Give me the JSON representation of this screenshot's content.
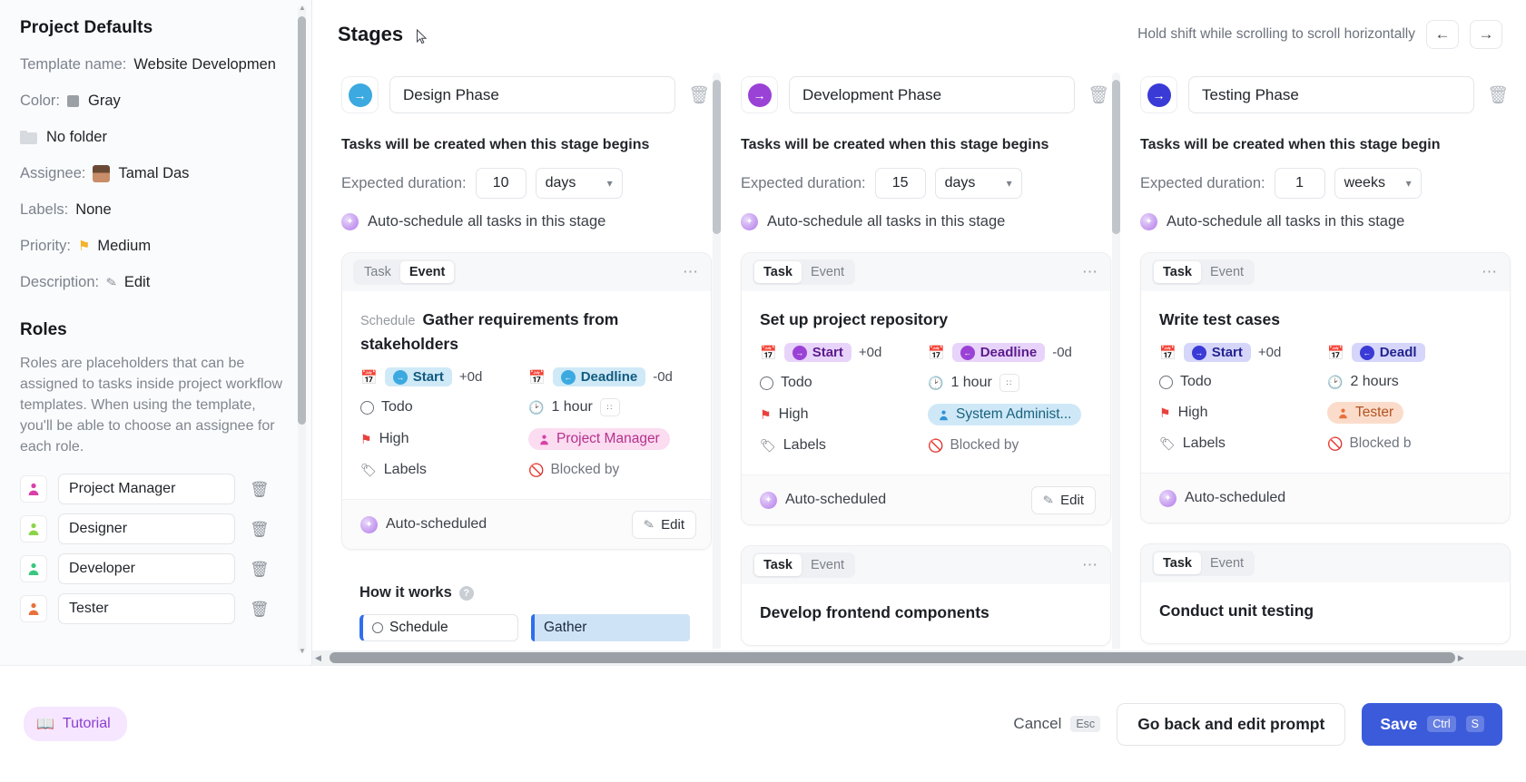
{
  "sidebar": {
    "title": "Project Defaults",
    "fields": [
      {
        "label": "Template name:",
        "value": "Website Developmen"
      },
      {
        "label": "Color:",
        "value": "Gray"
      },
      {
        "label": "",
        "value": "No folder"
      },
      {
        "label": "Assignee:",
        "value": "Tamal Das"
      },
      {
        "label": "Labels:",
        "value": "None"
      },
      {
        "label": "Priority:",
        "value": "Medium"
      },
      {
        "label": "Description:",
        "value": "Edit"
      }
    ],
    "roles_title": "Roles",
    "roles_description": "Roles are placeholders that can be assigned to tasks inside project workflow templates. When using the template, you'll be able to choose an assignee for each role.",
    "roles": [
      {
        "name": "Project Manager",
        "color": "#d93fa8"
      },
      {
        "name": "Designer",
        "color": "#8bd44a"
      },
      {
        "name": "Developer",
        "color": "#3ac77f"
      },
      {
        "name": "Tester",
        "color": "#e8713c"
      }
    ]
  },
  "header": {
    "title": "Stages",
    "scroll_hint": "Hold shift while scrolling to scroll horizontally",
    "prev_label": "←",
    "next_label": "→"
  },
  "stages": [
    {
      "name": "Design Phase",
      "accent": "#3ca9e0",
      "accent_soft": "#cfe9f7",
      "accent_text": "#115b80",
      "tasks_note": "Tasks will be created when this stage begins",
      "duration_label": "Expected duration:",
      "duration_value": "10",
      "duration_unit": "days",
      "auto_schedule_label": "Auto-schedule all tasks in this stage",
      "cards": [
        {
          "tabs": [
            "Task",
            "Event"
          ],
          "active_tab": "Event",
          "schedule_prefix": "Schedule",
          "title": "Gather requirements from stakeholders",
          "start_label": "Start",
          "start_offset": "+0d",
          "deadline_label": "Deadline",
          "deadline_offset": "-0d",
          "status": "Todo",
          "duration": "1 hour",
          "priority": "High",
          "assignee": "Project Manager",
          "assignee_bg": "#fbdcf0",
          "assignee_fg": "#b5308d",
          "labels_label": "Labels",
          "blocked_label": "Blocked by",
          "footer_label": "Auto-scheduled",
          "edit_label": "Edit"
        }
      ],
      "how_it_works": {
        "title": "How it works",
        "chip_left": "Schedule",
        "chip_right": "Gather"
      }
    },
    {
      "name": "Development Phase",
      "accent": "#9b42d6",
      "accent_soft": "#e8d4fa",
      "accent_text": "#5b1a8c",
      "tasks_note": "Tasks will be created when this stage begins",
      "duration_label": "Expected duration:",
      "duration_value": "15",
      "duration_unit": "days",
      "auto_schedule_label": "Auto-schedule all tasks in this stage",
      "cards": [
        {
          "tabs": [
            "Task",
            "Event"
          ],
          "active_tab": "Task",
          "schedule_prefix": "",
          "title": "Set up project repository",
          "start_label": "Start",
          "start_offset": "+0d",
          "deadline_label": "Deadline",
          "deadline_offset": "-0d",
          "status": "Todo",
          "duration": "1 hour",
          "priority": "High",
          "assignee": "System Administ...",
          "assignee_bg": "#cfe8f7",
          "assignee_fg": "#18627f",
          "labels_label": "Labels",
          "blocked_label": "Blocked by",
          "footer_label": "Auto-scheduled",
          "edit_label": "Edit"
        },
        {
          "tabs": [
            "Task",
            "Event"
          ],
          "active_tab": "Task",
          "title": "Develop frontend components"
        }
      ]
    },
    {
      "name": "Testing Phase",
      "accent": "#3a3ad6",
      "accent_soft": "#d6d6fb",
      "accent_text": "#23238f",
      "tasks_note": "Tasks will be created when this stage begin",
      "duration_label": "Expected duration:",
      "duration_value": "1",
      "duration_unit": "weeks",
      "auto_schedule_label": "Auto-schedule all tasks in this stage",
      "cards": [
        {
          "tabs": [
            "Task",
            "Event"
          ],
          "active_tab": "Task",
          "schedule_prefix": "",
          "title": "Write test cases",
          "start_label": "Start",
          "start_offset": "+0d",
          "deadline_label": "Deadl",
          "deadline_offset": "",
          "status": "Todo",
          "duration": "2 hours",
          "priority": "High",
          "assignee": "Tester",
          "assignee_bg": "#fbdccb",
          "assignee_fg": "#b2531f",
          "labels_label": "Labels",
          "blocked_label": "Blocked b",
          "footer_label": "Auto-scheduled",
          "edit_label": "Edit"
        },
        {
          "tabs": [
            "Task",
            "Event"
          ],
          "active_tab": "Task",
          "title": "Conduct unit testing"
        }
      ]
    }
  ],
  "footer": {
    "tutorial_label": "Tutorial",
    "cancel_label": "Cancel",
    "cancel_key": "Esc",
    "goback_label": "Go back and edit prompt",
    "save_label": "Save",
    "save_key1": "Ctrl",
    "save_key2": "S"
  }
}
